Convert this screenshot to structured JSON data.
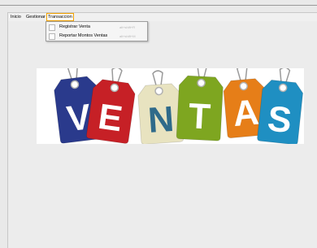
{
  "menubar": {
    "items": [
      "Inicio",
      "Gestionar",
      "Transaccion"
    ]
  },
  "dropdown": {
    "items": [
      {
        "label": "Registrar Venta",
        "accelerator": "alt+shift+R"
      },
      {
        "label": "Reportar Montos Ventas",
        "accelerator": "alt+shift+M"
      }
    ]
  },
  "banner": {
    "letters": [
      "V",
      "E",
      "N",
      "T",
      "A",
      "S"
    ],
    "tag_colors": [
      "#2a3a8c",
      "#c62026",
      "#e8e3c0",
      "#7ea620",
      "#e67e18",
      "#1f8fc2"
    ],
    "letter_colors": [
      "#ffffff",
      "#ffffff",
      "#2f6a8a",
      "#ffffff",
      "#ffffff",
      "#ffffff"
    ]
  }
}
